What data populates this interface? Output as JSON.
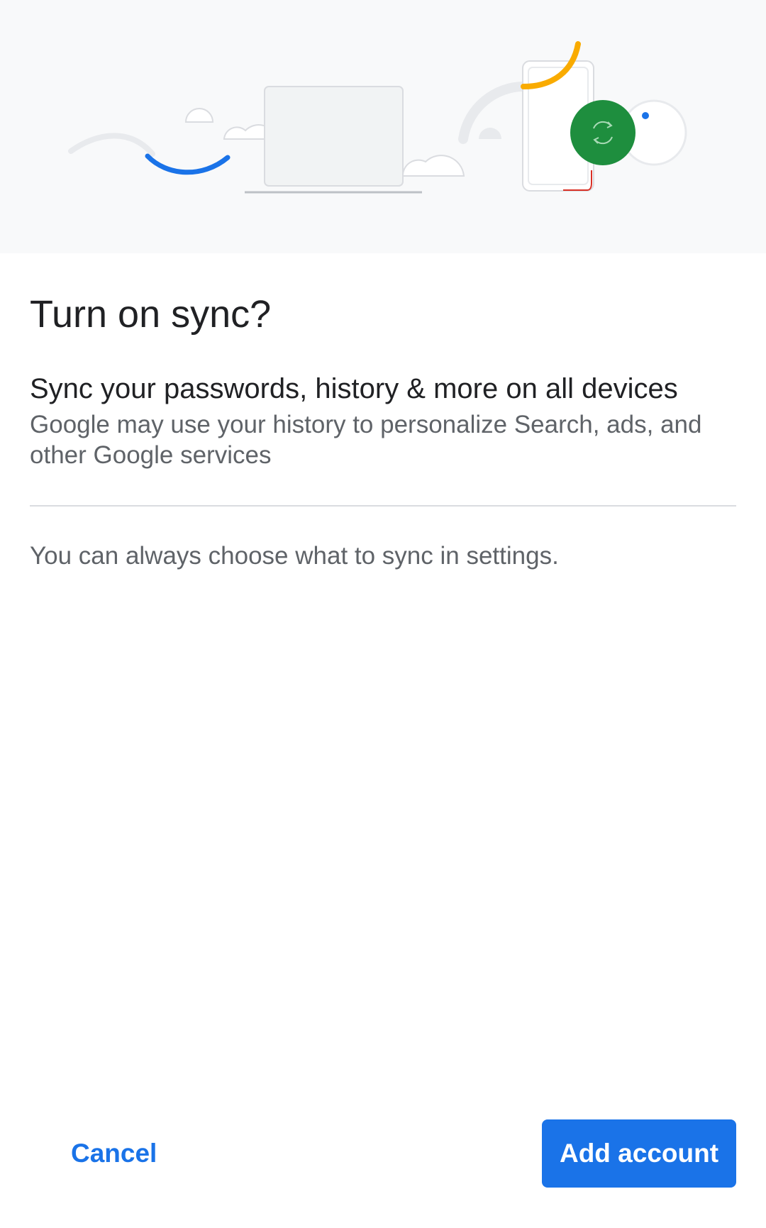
{
  "dialog": {
    "title": "Turn on sync?",
    "heading": "Sync your passwords, history & more on all devices",
    "description": "Google may use your history to personalize Search, ads, and other Google services",
    "note": "You can always choose what to sync in settings."
  },
  "actions": {
    "cancel_label": "Cancel",
    "add_account_label": "Add account"
  },
  "illustration": {
    "icons": [
      "sync-icon",
      "laptop-icon",
      "phone-icon",
      "cloud-icon"
    ]
  },
  "colors": {
    "accent": "#1a73e8",
    "green": "#1e8e3e",
    "yellow": "#f9ab00",
    "red": "#d93025",
    "hero_bg": "#f8f9fa",
    "text_primary": "#202124",
    "text_secondary": "#5f6368"
  }
}
